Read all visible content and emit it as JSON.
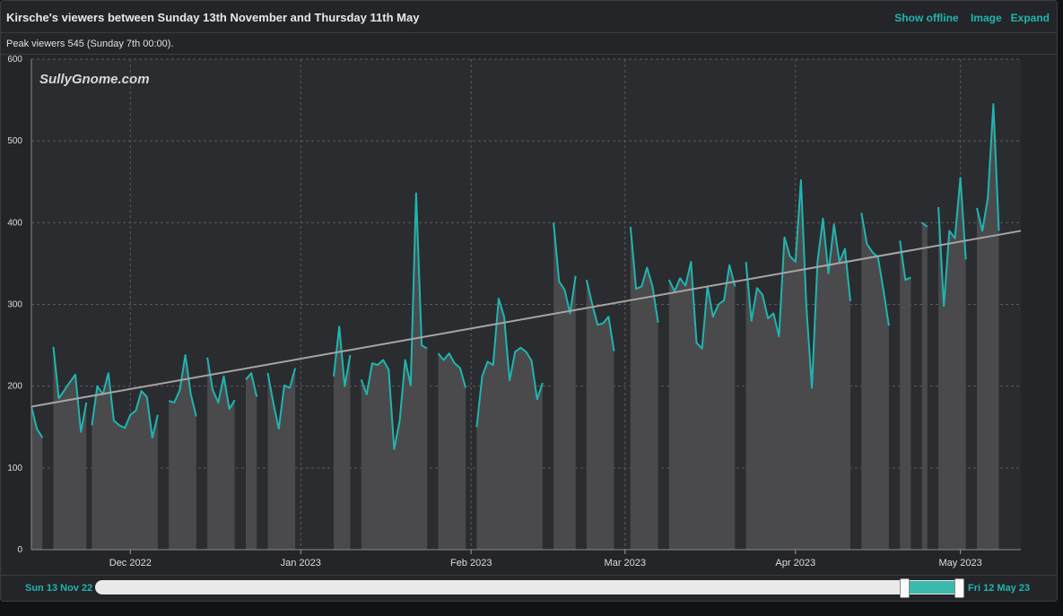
{
  "header": {
    "title": "Kirsche's viewers between Sunday 13th November and Thursday 11th May",
    "show_offline": "Show offline",
    "image": "Image",
    "expand": "Expand"
  },
  "subheader": "Peak viewers 545 (Sunday 7th 00:00).",
  "watermark": "SullyGnome.com",
  "range": {
    "start_label": "Sun 13 Nov 22",
    "end_label": "Fri 12 May 23",
    "selected_fraction": [
      0.93,
      1.0
    ]
  },
  "colors": {
    "line": "#1fb5b0",
    "area": "#4a4a4d",
    "trend": "#a5a5a5",
    "grid": "#5a5b5f",
    "accent": "#1fb5b0"
  },
  "chart_data": {
    "type": "area",
    "title": "Kirsche's viewers between Sunday 13th November and Thursday 11th May",
    "ylabel": "",
    "xlabel": "",
    "ylim": [
      0,
      600
    ],
    "yticks": [
      0,
      100,
      200,
      300,
      400,
      500,
      600
    ],
    "xlim": [
      "2022-11-13",
      "2023-05-12"
    ],
    "xticks": [
      {
        "date": "2022-12-01",
        "label": "Dec 2022"
      },
      {
        "date": "2023-01-01",
        "label": "Jan 2023"
      },
      {
        "date": "2023-02-01",
        "label": "Feb 2023"
      },
      {
        "date": "2023-03-01",
        "label": "Mar 2023"
      },
      {
        "date": "2023-04-01",
        "label": "Apr 2023"
      },
      {
        "date": "2023-05-01",
        "label": "May 2023"
      }
    ],
    "grid": true,
    "trend_line": {
      "start": [
        "2022-11-13",
        175
      ],
      "end": [
        "2023-05-12",
        390
      ]
    },
    "segments": [
      [
        [
          "2022-11-13",
          175
        ],
        [
          "2022-11-14",
          148
        ],
        [
          "2022-11-15",
          137
        ]
      ],
      [
        [
          "2022-11-17",
          248
        ],
        [
          "2022-11-18",
          185
        ],
        [
          "2022-11-19",
          195
        ],
        [
          "2022-11-20",
          205
        ],
        [
          "2022-11-21",
          214
        ],
        [
          "2022-11-22",
          144
        ],
        [
          "2022-11-23",
          180
        ]
      ],
      [
        [
          "2022-11-24",
          152
        ],
        [
          "2022-11-25",
          200
        ],
        [
          "2022-11-26",
          190
        ],
        [
          "2022-11-27",
          216
        ],
        [
          "2022-11-28",
          158
        ],
        [
          "2022-11-29",
          152
        ],
        [
          "2022-11-30",
          149
        ],
        [
          "2022-12-01",
          165
        ],
        [
          "2022-12-02",
          170
        ],
        [
          "2022-12-03",
          194
        ],
        [
          "2022-12-04",
          187
        ],
        [
          "2022-12-05",
          137
        ],
        [
          "2022-12-06",
          165
        ]
      ],
      [
        [
          "2022-12-08",
          182
        ],
        [
          "2022-12-09",
          180
        ],
        [
          "2022-12-10",
          195
        ],
        [
          "2022-12-11",
          238
        ],
        [
          "2022-12-12",
          190
        ],
        [
          "2022-12-13",
          163
        ]
      ],
      [
        [
          "2022-12-15",
          235
        ],
        [
          "2022-12-16",
          195
        ],
        [
          "2022-12-17",
          180
        ],
        [
          "2022-12-18",
          212
        ],
        [
          "2022-12-19",
          172
        ],
        [
          "2022-12-20",
          183
        ]
      ],
      [
        [
          "2022-12-22",
          208
        ],
        [
          "2022-12-23",
          216
        ],
        [
          "2022-12-24",
          187
        ]
      ],
      [
        [
          "2022-12-26",
          216
        ],
        [
          "2022-12-27",
          180
        ],
        [
          "2022-12-28",
          148
        ],
        [
          "2022-12-29",
          201
        ],
        [
          "2022-12-30",
          198
        ],
        [
          "2022-12-31",
          222
        ]
      ],
      [
        [
          "2023-01-07",
          212
        ],
        [
          "2023-01-08",
          273
        ],
        [
          "2023-01-09",
          200
        ],
        [
          "2023-01-10",
          238
        ]
      ],
      [
        [
          "2023-01-12",
          208
        ],
        [
          "2023-01-13",
          190
        ],
        [
          "2023-01-14",
          228
        ],
        [
          "2023-01-15",
          226
        ],
        [
          "2023-01-16",
          232
        ],
        [
          "2023-01-17",
          220
        ],
        [
          "2023-01-18",
          123
        ],
        [
          "2023-01-19",
          158
        ],
        [
          "2023-01-20",
          232
        ],
        [
          "2023-01-21",
          201
        ],
        [
          "2023-01-22",
          436
        ],
        [
          "2023-01-23",
          250
        ],
        [
          "2023-01-24",
          246
        ]
      ],
      [
        [
          "2023-01-26",
          240
        ],
        [
          "2023-01-27",
          232
        ],
        [
          "2023-01-28",
          240
        ],
        [
          "2023-01-29",
          228
        ],
        [
          "2023-01-30",
          222
        ],
        [
          "2023-01-31",
          198
        ]
      ],
      [
        [
          "2023-02-02",
          150
        ],
        [
          "2023-02-03",
          212
        ],
        [
          "2023-02-04",
          230
        ],
        [
          "2023-02-05",
          226
        ],
        [
          "2023-02-06",
          307
        ],
        [
          "2023-02-07",
          285
        ],
        [
          "2023-02-08",
          207
        ],
        [
          "2023-02-09",
          242
        ],
        [
          "2023-02-10",
          247
        ],
        [
          "2023-02-11",
          242
        ],
        [
          "2023-02-12",
          231
        ],
        [
          "2023-02-13",
          184
        ],
        [
          "2023-02-14",
          204
        ]
      ],
      [
        [
          "2023-02-16",
          400
        ],
        [
          "2023-02-17",
          328
        ],
        [
          "2023-02-18",
          318
        ],
        [
          "2023-02-19",
          289
        ],
        [
          "2023-02-20",
          335
        ]
      ],
      [
        [
          "2023-02-22",
          330
        ],
        [
          "2023-02-23",
          301
        ],
        [
          "2023-02-24",
          275
        ],
        [
          "2023-02-25",
          277
        ],
        [
          "2023-02-26",
          285
        ],
        [
          "2023-02-27",
          243
        ]
      ],
      [
        [
          "2023-03-02",
          395
        ],
        [
          "2023-03-03",
          319
        ],
        [
          "2023-03-04",
          322
        ],
        [
          "2023-03-05",
          345
        ],
        [
          "2023-03-06",
          322
        ],
        [
          "2023-03-07",
          278
        ]
      ],
      [
        [
          "2023-03-09",
          330
        ],
        [
          "2023-03-10",
          316
        ],
        [
          "2023-03-11",
          332
        ],
        [
          "2023-03-12",
          323
        ],
        [
          "2023-03-13",
          352
        ],
        [
          "2023-03-14",
          253
        ],
        [
          "2023-03-15",
          246
        ],
        [
          "2023-03-16",
          322
        ],
        [
          "2023-03-17",
          285
        ],
        [
          "2023-03-18",
          300
        ],
        [
          "2023-03-19",
          305
        ],
        [
          "2023-03-20",
          348
        ],
        [
          "2023-03-21",
          322
        ]
      ],
      [
        [
          "2023-03-23",
          352
        ],
        [
          "2023-03-24",
          280
        ],
        [
          "2023-03-25",
          320
        ],
        [
          "2023-03-26",
          312
        ],
        [
          "2023-03-27",
          283
        ],
        [
          "2023-03-28",
          289
        ],
        [
          "2023-03-29",
          261
        ],
        [
          "2023-03-30",
          382
        ],
        [
          "2023-03-31",
          359
        ],
        [
          "2023-04-01",
          352
        ],
        [
          "2023-04-02",
          452
        ],
        [
          "2023-04-03",
          296
        ],
        [
          "2023-04-04",
          198
        ],
        [
          "2023-04-05",
          352
        ],
        [
          "2023-04-06",
          405
        ],
        [
          "2023-04-07",
          338
        ],
        [
          "2023-04-08",
          398
        ],
        [
          "2023-04-09",
          352
        ],
        [
          "2023-04-10",
          368
        ],
        [
          "2023-04-11",
          304
        ]
      ],
      [
        [
          "2023-04-13",
          412
        ],
        [
          "2023-04-14",
          374
        ],
        [
          "2023-04-15",
          364
        ],
        [
          "2023-04-16",
          358
        ],
        [
          "2023-04-17",
          318
        ],
        [
          "2023-04-18",
          274
        ]
      ],
      [
        [
          "2023-04-20",
          378
        ],
        [
          "2023-04-21",
          330
        ],
        [
          "2023-04-22",
          333
        ]
      ],
      [
        [
          "2023-04-24",
          400
        ],
        [
          "2023-04-25",
          395
        ]
      ],
      [
        [
          "2023-04-27",
          419
        ],
        [
          "2023-04-28",
          298
        ],
        [
          "2023-04-29",
          390
        ],
        [
          "2023-04-30",
          381
        ],
        [
          "2023-05-01",
          455
        ],
        [
          "2023-05-02",
          355
        ]
      ],
      [
        [
          "2023-05-04",
          418
        ],
        [
          "2023-05-05",
          390
        ],
        [
          "2023-05-06",
          430
        ],
        [
          "2023-05-07",
          545
        ],
        [
          "2023-05-08",
          390
        ]
      ]
    ]
  }
}
